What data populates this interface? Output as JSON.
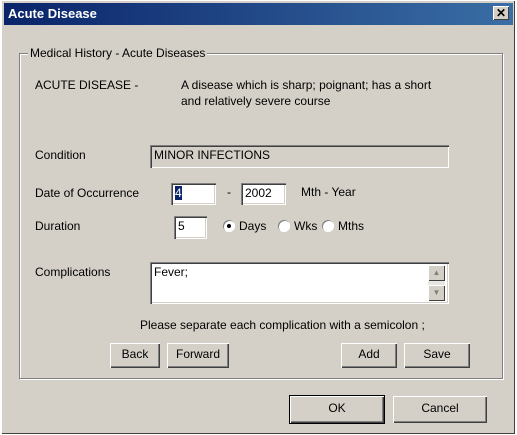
{
  "window": {
    "title": "Acute Disease",
    "close_glyph": "✕"
  },
  "group": {
    "legend": "Medical History - Acute Diseases",
    "definition_term": "ACUTE DISEASE -",
    "definition_line1": "A disease which is sharp; poignant; has a short",
    "definition_line2": "and relatively severe course"
  },
  "condition": {
    "label": "Condition",
    "value": "MINOR INFECTIONS"
  },
  "occurrence": {
    "label": "Date of Occurrence",
    "month": "4",
    "separator": "-",
    "year": "2002",
    "format_hint": "Mth - Year"
  },
  "duration": {
    "label": "Duration",
    "value": "5",
    "units": [
      {
        "label": "Days",
        "selected": true
      },
      {
        "label": "Wks",
        "selected": false
      },
      {
        "label": "Mths",
        "selected": false
      }
    ]
  },
  "complications": {
    "label": "Complications",
    "value": "Fever;",
    "hint": "Please separate each complication with a semicolon ;"
  },
  "buttons": {
    "back": "Back",
    "forward": "Forward",
    "add": "Add",
    "save": "Save",
    "ok": "OK",
    "cancel": "Cancel"
  },
  "icons": {
    "scroll_up": "scroll-up-icon",
    "scroll_down": "scroll-down-icon",
    "close": "close-icon"
  }
}
